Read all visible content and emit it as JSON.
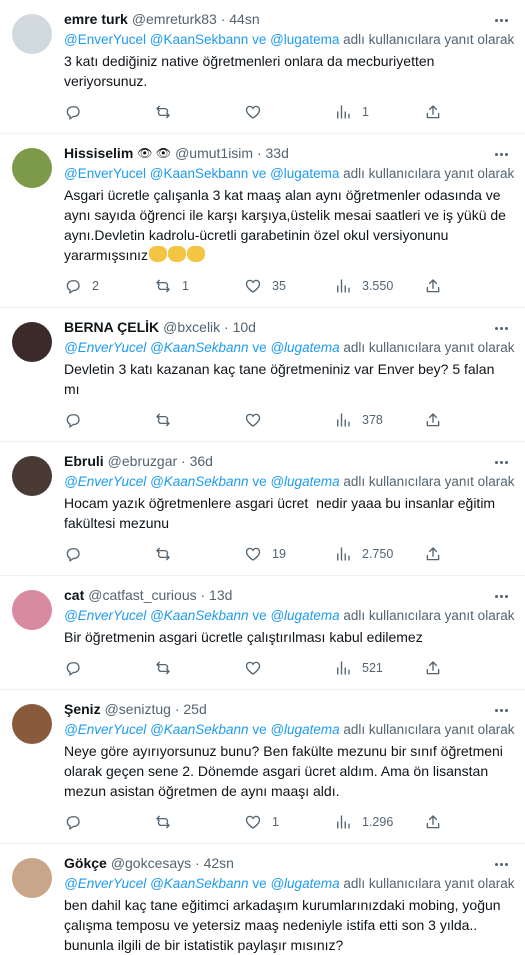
{
  "reply_suffix": "adlı kullanıcılara yanıt olarak",
  "tweets": [
    {
      "name": "emre turk",
      "handle": "@emreturk83 · 44sn",
      "mentions": [
        "@EnverYucel",
        "@KaanSekbann",
        "ve",
        "@lugatema"
      ],
      "text": "3 katı dediğiniz native öğretmenleri onlara da mecburiyetten veriyorsunuz.",
      "stats": {
        "reply": "",
        "retweet": "",
        "like": "",
        "views": "1"
      },
      "avatar_color": "#cfd9de"
    },
    {
      "name": "Hissiselim",
      "emoji": "👁 👁",
      "handle": "@umut1isim · 33d",
      "mentions": [
        "@EnverYucel",
        "@KaanSekbann",
        "ve",
        "@lugatema"
      ],
      "text": "Asgari ücretle çalışanla 3 kat maaş alan aynı öğretmenler odasında ve aynı sayıda öğrenci ile karşı karşıya,üstelik mesai saatleri ve iş yükü de aynı.Devletin kadrolu-ücretli garabetinin özel okul versiyonunu yararmışsınız",
      "stats": {
        "reply": "2",
        "retweet": "1",
        "like": "35",
        "views": "3.550"
      },
      "avatar_color": "#7c9a4a"
    },
    {
      "name": "BERNA ÇELİK",
      "handle": "@bxcelik · 10d",
      "mentions": [
        "@EnverYucel",
        "@KaanSekbann",
        "ve",
        "@lugatema"
      ],
      "text": "Devletin 3 katı kazanan kaç tane öğretmeniniz var Enver bey? 5 falan mı",
      "stats": {
        "reply": "",
        "retweet": "",
        "like": "",
        "views": "378"
      },
      "avatar_color": "#3b2a2a"
    },
    {
      "name": "Ebruli",
      "handle": "@ebruzgar · 36d",
      "mentions": [
        "@EnverYucel",
        "@KaanSekbann",
        "ve",
        "@lugatema"
      ],
      "text": "Hocam yazık öğretmenlere asgari ücret  nedir yaaa bu insanlar eğitim fakültesi mezunu",
      "stats": {
        "reply": "",
        "retweet": "",
        "like": "19",
        "views": "2.750"
      },
      "avatar_color": "#4a3a35"
    },
    {
      "name": "cat",
      "handle": "@catfast_curious · 13d",
      "mentions": [
        "@EnverYucel",
        "@KaanSekbann",
        "ve",
        "@lugatema"
      ],
      "text": "Bir öğretmenin asgari ücretle çalıştırılması kabul edilemez",
      "stats": {
        "reply": "",
        "retweet": "",
        "like": "",
        "views": "521"
      },
      "avatar_color": "#d88aa0"
    },
    {
      "name": "Şeniz",
      "handle": "@seniztug · 25d",
      "mentions": [
        "@EnverYucel",
        "@KaanSekbann",
        "ve",
        "@lugatema"
      ],
      "text": "Neye göre ayırıyorsunuz bunu? Ben fakülte mezunu bir sınıf öğretmeni olarak geçen sene 2. Dönemde asgari ücret aldım. Ama ön lisanstan mezun asistan öğretmen de aynı maaşı aldı.",
      "stats": {
        "reply": "",
        "retweet": "",
        "like": "1",
        "views": "1.296"
      },
      "avatar_color": "#8a5a3c"
    },
    {
      "name": "Gökçe",
      "handle": "@gokcesays · 42sn",
      "mentions": [
        "@EnverYucel",
        "@KaanSekbann",
        "ve",
        "@lugatema"
      ],
      "text": "ben dahil kaç tane eğitimci arkadaşım kurumlarınızdaki mobing, yoğun çalışma temposu ve yetersiz maaş nedeniyle istifa etti son 3 yılda.. bununla ilgili de bir istatistik paylaşır mısınız?",
      "stats": {
        "reply": "",
        "retweet": "",
        "like": "",
        "views": ""
      },
      "avatar_color": "#c9a68a"
    }
  ]
}
